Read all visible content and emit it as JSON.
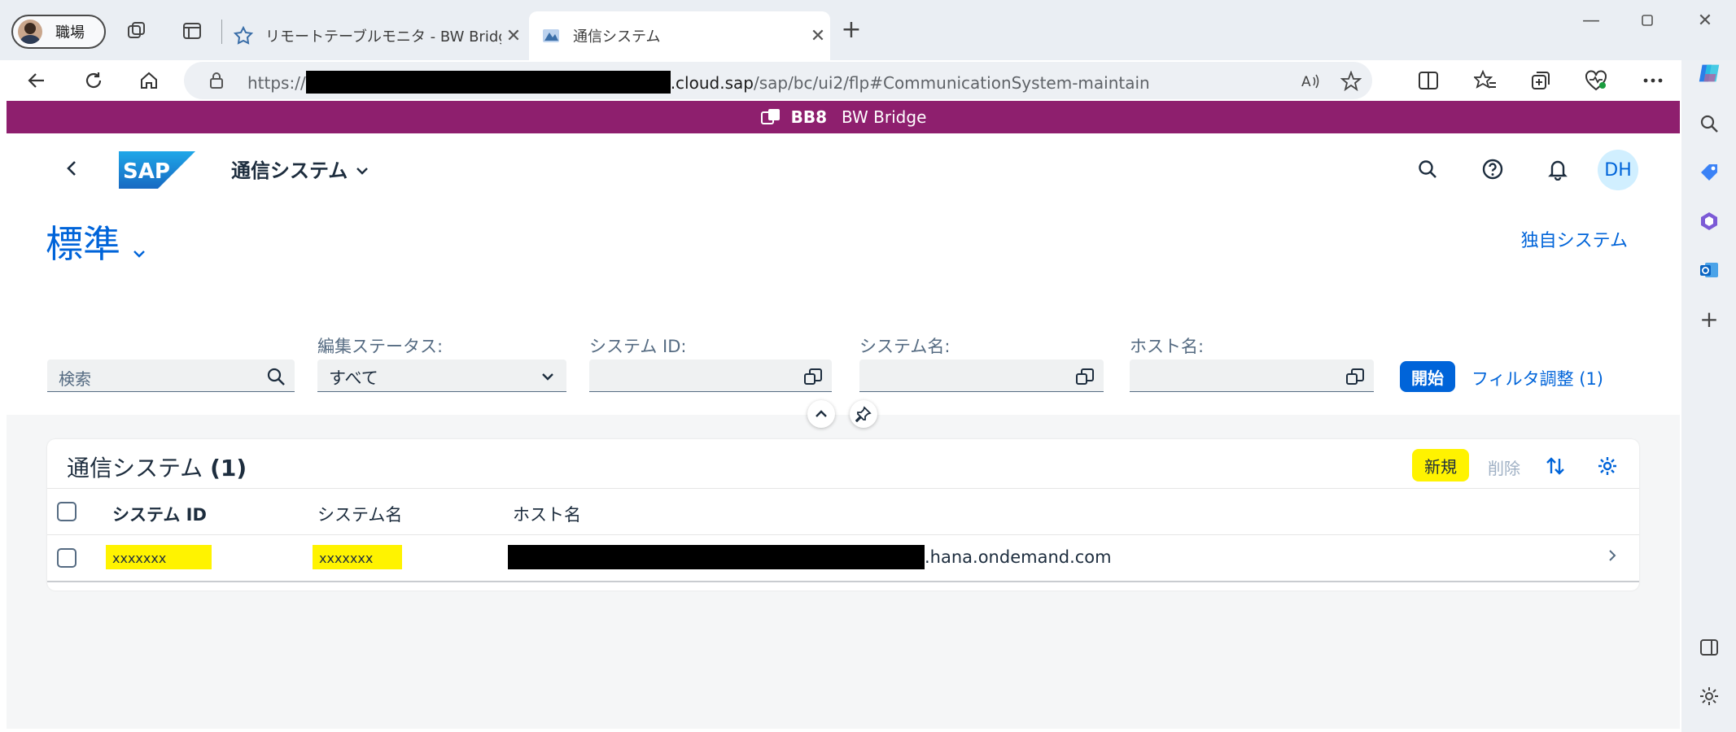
{
  "browser": {
    "profile": {
      "label": "職場"
    },
    "tabs": [
      {
        "title": "リモートテーブルモニタ - BW Bridge (S",
        "active": false
      },
      {
        "title": "通信システム",
        "active": true
      }
    ],
    "url": {
      "prefix": "https://",
      "domain": ".cloud.sap",
      "path": "/sap/bc/ui2/flp#CommunicationSystem-maintain"
    },
    "icons": [
      "back-icon",
      "reload-icon",
      "home-icon",
      "lock-icon",
      "read-aloud-icon",
      "favorite-star-icon",
      "split-screen-icon",
      "favorites-icon",
      "collections-icon",
      "browser-essentials-icon",
      "more-icon",
      "copilot-icon"
    ]
  },
  "shell": {
    "system_id": "BB8",
    "system_name": "BW Bridge",
    "app_title": "通信システム",
    "avatar": "DH"
  },
  "header": {
    "variant": "標準",
    "own_system_link": "独自システム"
  },
  "filters": {
    "search_placeholder": "検索",
    "edit_status_label": "編集ステータス:",
    "edit_status_value": "すべて",
    "system_id_label": "システム ID:",
    "system_name_label": "システム名:",
    "host_name_label": "ホスト名:",
    "go_label": "開始",
    "adapt_label": "フィルタ調整 (1)"
  },
  "table": {
    "title": "通信システム",
    "count": "(1)",
    "new_label": "新規",
    "delete_label": "削除",
    "columns": [
      "システム ID",
      "システム名",
      "ホスト名"
    ],
    "rows": [
      {
        "system_id": "xxxxxxx",
        "system_name": "xxxxxxx",
        "host_suffix": ".hana.ondemand.com"
      }
    ]
  },
  "colors": {
    "shell_bar": "#8e1f6e",
    "accent": "#0064d9",
    "highlight": "#fff300"
  }
}
